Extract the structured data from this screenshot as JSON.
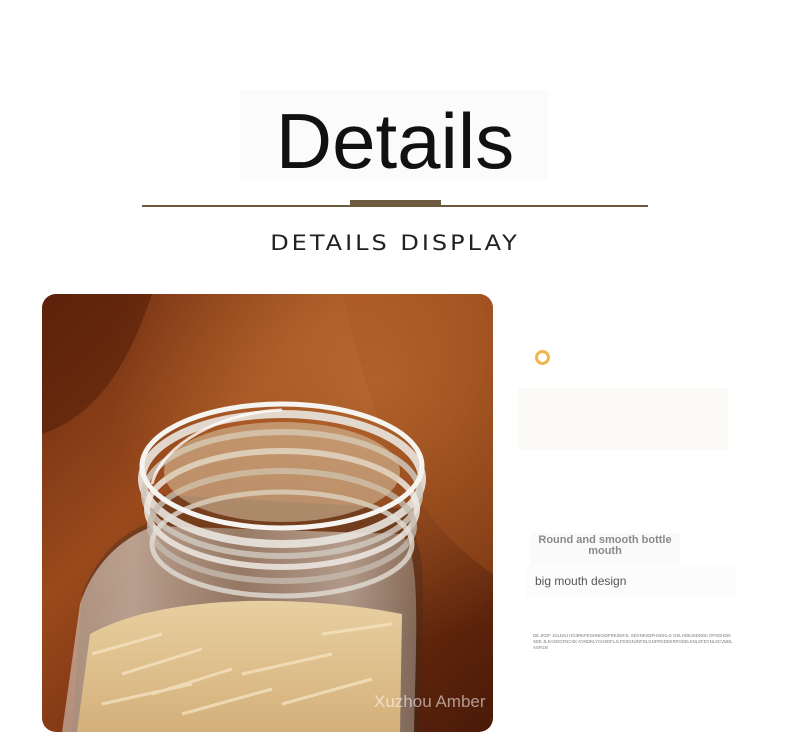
{
  "header": {
    "title": "Details",
    "subtitle": "DETAILS DISPLAY"
  },
  "photo": {
    "watermark": "Xuzhou Amber"
  },
  "feature": {
    "title": "Round and smooth bottle mouth",
    "subtitle": "big mouth design",
    "fine_print": "DE JKDF JGLDSJ HG3RKFEGHNKSDFRKSDFJL SDVNKSDFHSDKLG OSLHOE15DNGK DFSGHDNSDE JLKASDGFNCXK KVNDKLYCHSDFLJLFDSGNJNFDLGNFRGDEKRFOSELKNLSFDYNLXCVNDL ASFGN"
  },
  "colors": {
    "accent_gold": "#f0b54b",
    "divider_brown": "#6d5c40",
    "title_text": "#111111"
  },
  "icons": {
    "ring": "ring-icon"
  }
}
